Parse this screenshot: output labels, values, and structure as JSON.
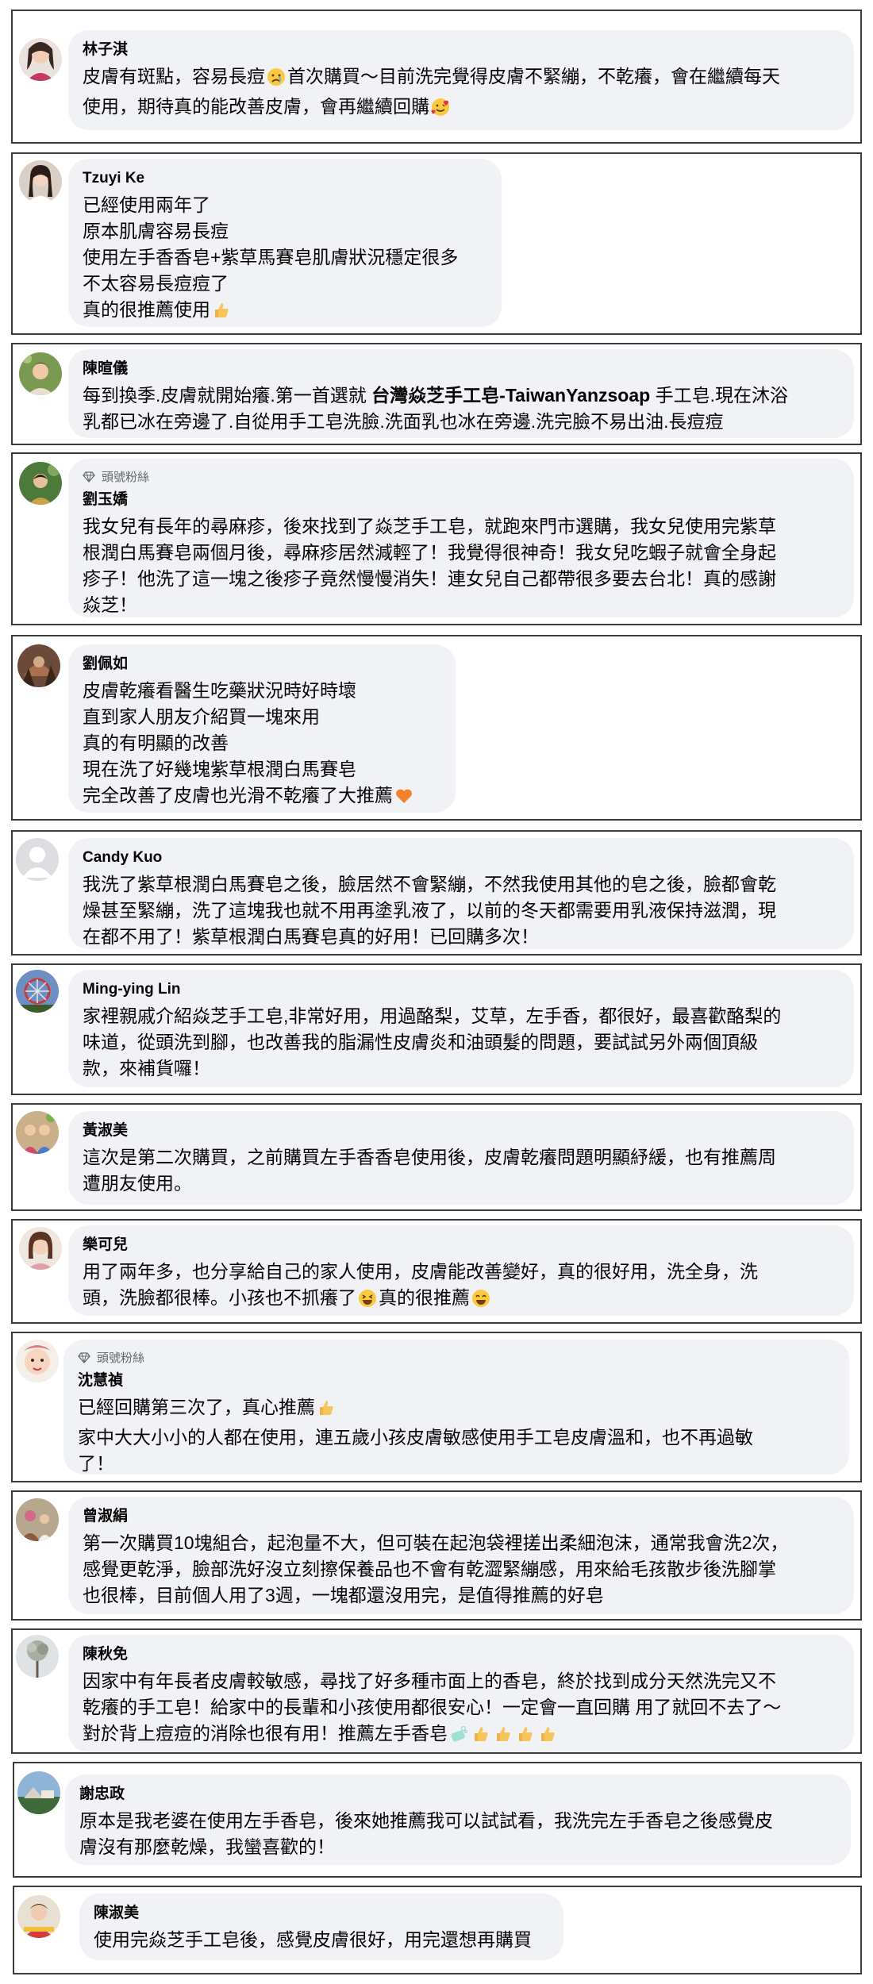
{
  "comments": [
    {
      "name": "林子淇",
      "fan_badge": null,
      "lines": [
        [
          {
            "t": "皮膚有斑點，容易長痘"
          },
          {
            "emoji": "sad-face-icon"
          },
          {
            "t": "首次購買～目前洗完覺得皮膚不緊繃，不乾癢，會在繼續每天"
          }
        ],
        [
          {
            "t": "使用，期待真的能改善皮膚，會再繼續回購"
          },
          {
            "emoji": "hearts-face-icon"
          }
        ]
      ]
    },
    {
      "name": "Tzuyi Ke",
      "fan_badge": null,
      "lines": [
        [
          {
            "t": "已經使用兩年了"
          }
        ],
        [
          {
            "t": "原本肌膚容易長痘"
          }
        ],
        [
          {
            "t": "使用左手香香皂+紫草馬賽皂肌膚狀況穩定很多"
          }
        ],
        [
          {
            "t": "不太容易長痘痘了"
          }
        ],
        [
          {
            "t": "真的很推薦使用"
          },
          {
            "emoji": "thumbs-up-icon"
          }
        ]
      ]
    },
    {
      "name": "陳暄儀",
      "fan_badge": null,
      "lines": [
        [
          {
            "t": "每到換季.皮膚就開始癢.第一首選就 "
          },
          {
            "t": "台灣焱芝手工皂-TaiwanYanzsoap",
            "bold": true
          },
          {
            "t": " 手工皂.現在沐浴"
          }
        ],
        [
          {
            "t": "乳都已冰在旁邊了.自從用手工皂洗臉.洗面乳也冰在旁邊.洗完臉不易出油.長痘痘"
          }
        ]
      ]
    },
    {
      "name": "劉玉嬌",
      "fan_badge": "頭號粉絲",
      "lines": [
        [
          {
            "t": "我女兒有長年的尋麻疹，後來找到了焱芝手工皂，就跑來門市選購，我女兒使用完紫草"
          }
        ],
        [
          {
            "t": "根潤白馬賽皂兩個月後，尋麻疹居然減輕了！我覺得很神奇！我女兒吃蝦子就會全身起"
          }
        ],
        [
          {
            "t": "疹子！他洗了這一塊之後疹子竟然慢慢消失！連女兒自己都帶很多要去台北！真的感謝"
          }
        ],
        [
          {
            "t": "焱芝！"
          }
        ]
      ]
    },
    {
      "name": "劉佩如",
      "fan_badge": null,
      "lines": [
        [
          {
            "t": "皮膚乾癢看醫生吃藥狀況時好時壞"
          }
        ],
        [
          {
            "t": "直到家人朋友介紹買一塊來用"
          }
        ],
        [
          {
            "t": "真的有明顯的改善"
          }
        ],
        [
          {
            "t": "現在洗了好幾塊紫草根潤白馬賽皂"
          }
        ],
        [
          {
            "t": "完全改善了皮膚也光滑不乾癢了大推薦"
          },
          {
            "emoji": "orange-heart-icon"
          }
        ]
      ]
    },
    {
      "name": "Candy Kuo",
      "fan_badge": null,
      "lines": [
        [
          {
            "t": "我洗了紫草根潤白馬賽皂之後，臉居然不會緊繃，不然我使用其他的皂之後，臉都會乾"
          }
        ],
        [
          {
            "t": "燥甚至緊繃，洗了這塊我也就不用再塗乳液了，以前的冬天都需要用乳液保持滋潤，現"
          }
        ],
        [
          {
            "t": "在都不用了！紫草根潤白馬賽皂真的好用！已回購多次！"
          }
        ]
      ]
    },
    {
      "name": "Ming-ying Lin",
      "fan_badge": null,
      "lines": [
        [
          {
            "t": "家裡親戚介紹焱芝手工皂,非常好用，用過酪梨，艾草，左手香，都很好，最喜歡酪梨的"
          }
        ],
        [
          {
            "t": "味道，從頭洗到腳，也改善我的脂漏性皮膚炎和油頭髮的問題，要試試另外兩個頂級"
          }
        ],
        [
          {
            "t": "款，來補貨囉！"
          }
        ]
      ]
    },
    {
      "name": "黃淑美",
      "fan_badge": null,
      "lines": [
        [
          {
            "t": "這次是第二次購買，之前購買左手香香皂使用後，皮膚乾癢問題明顯紓緩，也有推薦周"
          }
        ],
        [
          {
            "t": "遭朋友使用。"
          }
        ]
      ]
    },
    {
      "name": "樂可兒",
      "fan_badge": null,
      "lines": [
        [
          {
            "t": "用了兩年多，也分享給自己的家人使用，皮膚能改善變好，真的很好用，洗全身，洗"
          }
        ],
        [
          {
            "t": "頭，洗臉都很棒。小孩也不抓癢了"
          },
          {
            "emoji": "squint-laugh-icon"
          },
          {
            "t": "真的很推薦"
          },
          {
            "emoji": "smile-face-icon"
          }
        ]
      ]
    },
    {
      "name": "沈慧禎",
      "fan_badge": "頭號粉絲",
      "lines": [
        [
          {
            "t": "已經回購第三次了，真心推薦"
          },
          {
            "emoji": "thumbs-up-icon"
          }
        ],
        [
          {
            "t": "家中大大小小的人都在使用，連五歲小孩皮膚敏感使用手工皂皮膚溫和，也不再過敏"
          }
        ],
        [
          {
            "t": "了！"
          }
        ]
      ]
    },
    {
      "name": "曾淑絹",
      "fan_badge": null,
      "lines": [
        [
          {
            "t": "第一次購買10塊組合，起泡量不大，但可裝在起泡袋裡搓出柔細泡沫，通常我會洗2次，"
          }
        ],
        [
          {
            "t": "感覺更乾淨，臉部洗好沒立刻擦保養品也不會有乾澀緊繃感，用來給毛孩散步後洗腳掌"
          }
        ],
        [
          {
            "t": "也很棒，目前個人用了3週，一塊都還沒用完，是值得推薦的好皂"
          }
        ]
      ]
    },
    {
      "name": "陳秋免",
      "fan_badge": null,
      "lines": [
        [
          {
            "t": "因家中有年長者皮膚較敏感，尋找了好多種市面上的香皂，終於找到成分天然洗完又不"
          }
        ],
        [
          {
            "t": "乾癢的手工皂！給家中的長輩和小孩使用都很安心！一定會一直回購 用了就回不去了～"
          }
        ],
        [
          {
            "t": "對於背上痘痘的消除也很有用！推薦左手香皂"
          },
          {
            "emoji": "soap-icon"
          },
          {
            "emoji": "thumbs-up-icon"
          },
          {
            "emoji": "thumbs-up-icon"
          },
          {
            "emoji": "thumbs-up-icon"
          },
          {
            "emoji": "thumbs-up-icon"
          }
        ]
      ]
    },
    {
      "name": "謝忠政",
      "fan_badge": null,
      "lines": [
        [
          {
            "t": "原本是我老婆在使用左手香皂，後來她推薦我可以試試看，我洗完左手香皂之後感覺皮"
          }
        ],
        [
          {
            "t": "膚沒有那麼乾燥，我蠻喜歡的！"
          }
        ]
      ]
    },
    {
      "name": "陳淑美",
      "fan_badge": null,
      "lines": [
        [
          {
            "t": "使用完焱芝手工皂後，感覺皮膚很好，用完還想再購買"
          }
        ]
      ]
    }
  ]
}
